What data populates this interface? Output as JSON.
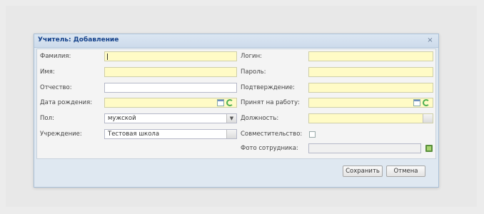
{
  "dialog": {
    "title": "Учитель: Добавление",
    "close_icon": "×"
  },
  "left_fields": [
    {
      "label": "Фамилия:",
      "value": "",
      "required": true,
      "focused": true
    },
    {
      "label": "Имя:",
      "value": "",
      "required": true
    },
    {
      "label": "Отчество:",
      "value": "",
      "required": false
    },
    {
      "label": "Дата рождения:",
      "value": "",
      "required": true,
      "type": "date"
    },
    {
      "label": "Пол:",
      "value": "мужской",
      "type": "select"
    },
    {
      "label": "Учреждение:",
      "value": "Тестовая школа",
      "type": "lookup"
    }
  ],
  "right_fields": [
    {
      "label": "Логин:",
      "value": "",
      "required": true
    },
    {
      "label": "Пароль:",
      "value": "",
      "required": true
    },
    {
      "label": "Подтверждение:",
      "value": "",
      "required": true
    },
    {
      "label": "Принят на работу:",
      "value": "",
      "required": true,
      "type": "date"
    },
    {
      "label": "Должность:",
      "value": "",
      "required": true,
      "type": "lookup"
    },
    {
      "label": "Совместительство:",
      "type": "checkbox",
      "checked": false
    },
    {
      "label": "Фото сотрудника:",
      "value": "",
      "type": "file"
    }
  ],
  "buttons": {
    "save": "Сохранить",
    "cancel": "Отмена"
  },
  "colors": {
    "required_bg": "#fffbc6",
    "title_text": "#15428b",
    "dialog_border": "#a9bfd6"
  }
}
